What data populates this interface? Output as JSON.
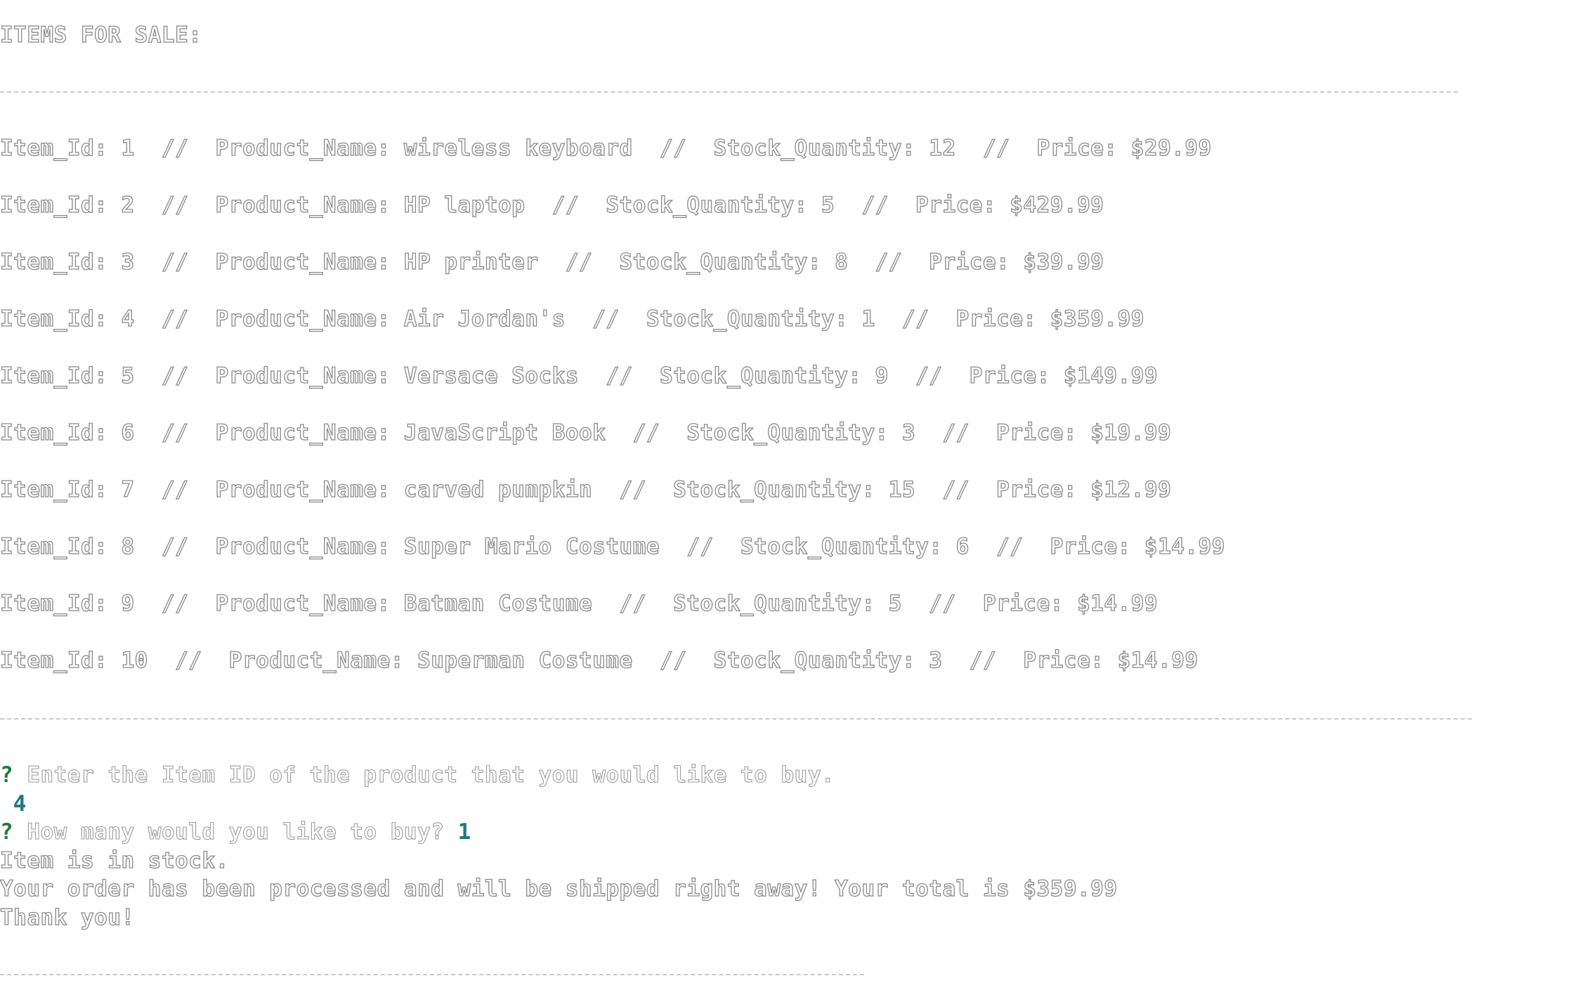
{
  "header": {
    "title": "ITEMS FOR SALE:"
  },
  "items": [
    {
      "line": "Item_Id: 1  //  Product_Name: wireless keyboard  //  Stock_Quantity: 12  //  Price: $29.99"
    },
    {
      "line": "Item_Id: 2  //  Product_Name: HP laptop  //  Stock_Quantity: 5  //  Price: $429.99"
    },
    {
      "line": "Item_Id: 3  //  Product_Name: HP printer  //  Stock_Quantity: 8  //  Price: $39.99"
    },
    {
      "line": "Item_Id: 4  //  Product_Name: Air Jordan's  //  Stock_Quantity: 1  //  Price: $359.99"
    },
    {
      "line": "Item_Id: 5  //  Product_Name: Versace Socks  //  Stock_Quantity: 9  //  Price: $149.99"
    },
    {
      "line": "Item_Id: 6  //  Product_Name: JavaScript Book  //  Stock_Quantity: 3  //  Price: $19.99"
    },
    {
      "line": "Item_Id: 7  //  Product_Name: carved pumpkin  //  Stock_Quantity: 15  //  Price: $12.99"
    },
    {
      "line": "Item_Id: 8  //  Product_Name: Super Mario Costume  //  Stock_Quantity: 6  //  Price: $14.99"
    },
    {
      "line": "Item_Id: 9  //  Product_Name: Batman Costume  //  Stock_Quantity: 5  //  Price: $14.99"
    },
    {
      "line": "Item_Id: 10  //  Product_Name: Superman Costume  //  Stock_Quantity: 3  //  Price: $14.99"
    }
  ],
  "prompts": {
    "q_mark": "?",
    "item_id_question": "Enter the Item ID of the product that you would like to buy.",
    "item_id_answer": "4",
    "quantity_question": "How many would you like to buy?",
    "quantity_answer": "1"
  },
  "output": {
    "stock_message": "Item is in stock.",
    "order_message": "Your order has been processed and will be shipped right away! Your total is $359.99",
    "thanks_message": "Thank you!"
  },
  "colors": {
    "text_outline": "#8a8a8a",
    "prompt_mark": "#1f7a3a",
    "answer": "#1e7880",
    "divider": "#c9c9c9"
  }
}
